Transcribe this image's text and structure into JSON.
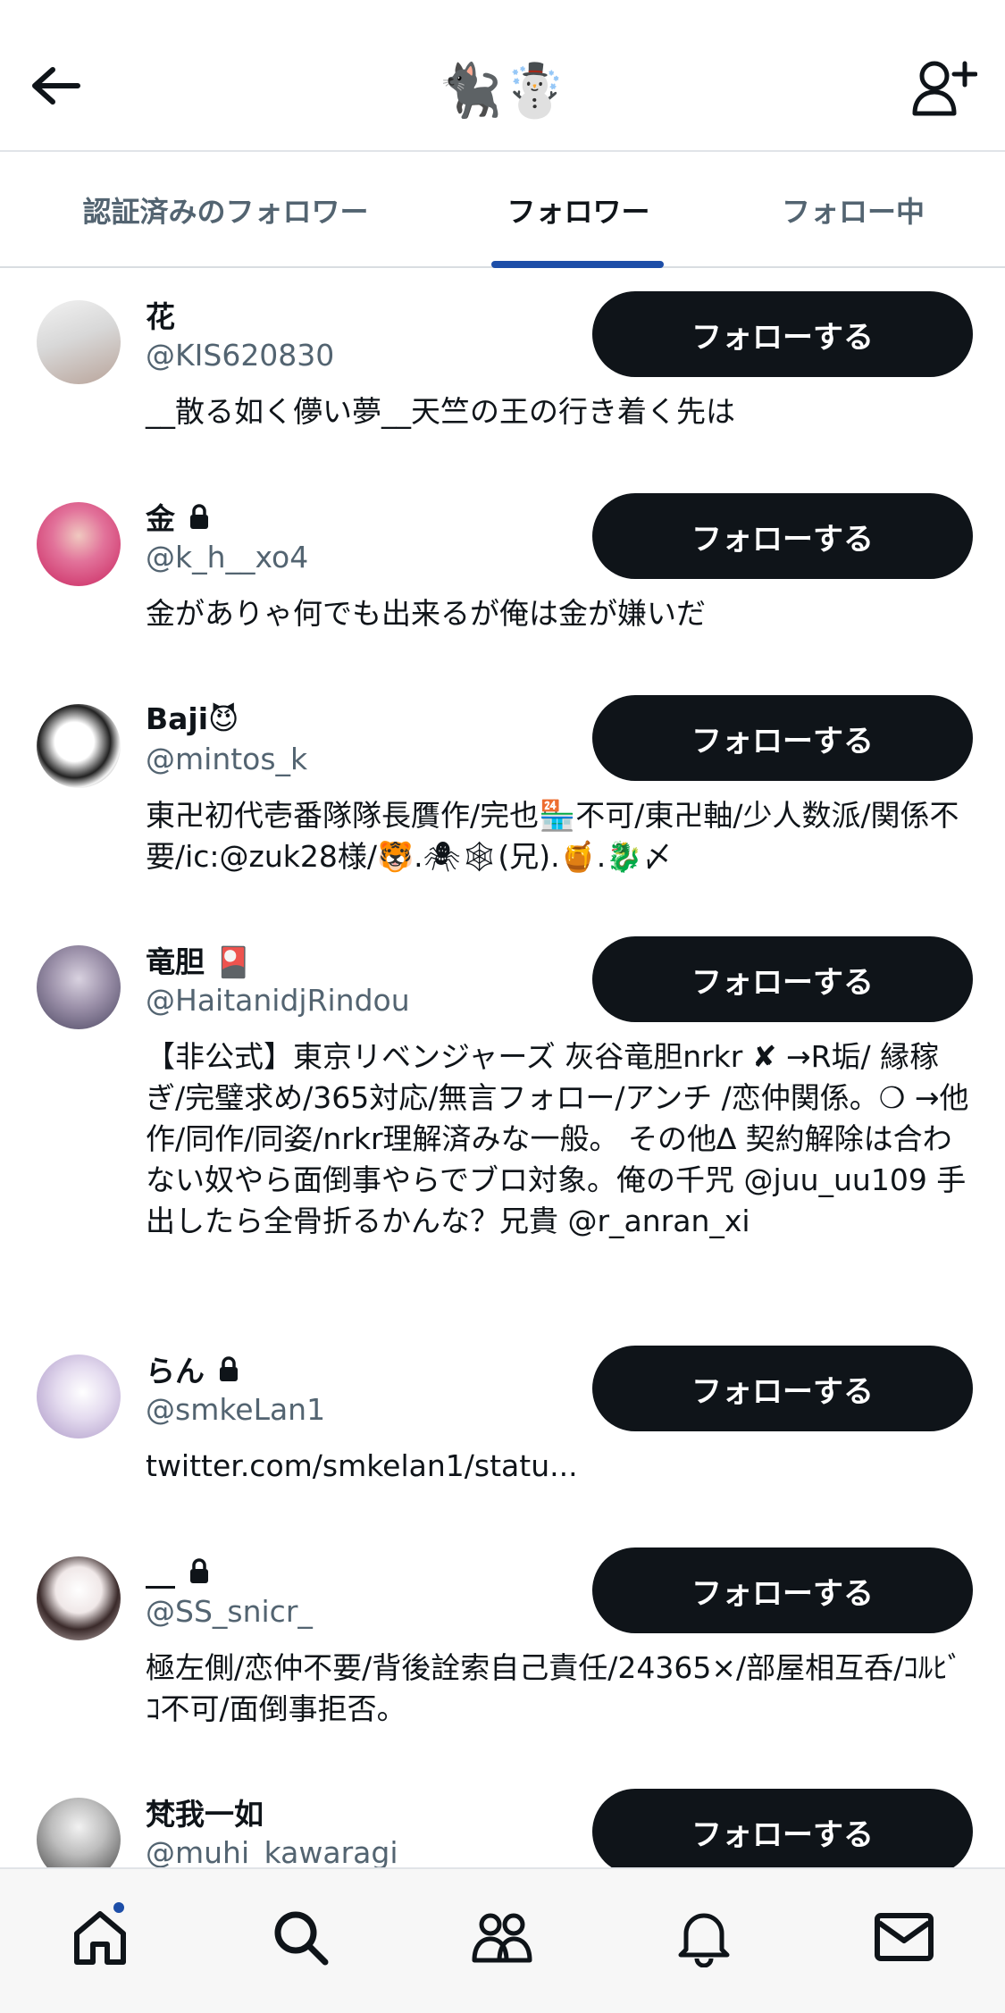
{
  "header": {
    "title": "🐈‍⬛☃️",
    "back_icon": "arrow-left-icon",
    "add_icon": "add-user-icon"
  },
  "tabs": [
    {
      "label": "認証済みのフォロワー",
      "active": false
    },
    {
      "label": "フォロワー",
      "active": true
    },
    {
      "label": "フォロー中",
      "active": false
    }
  ],
  "colors": {
    "accent": "#1d4ea8",
    "button_bg": "#0f1419",
    "secondary_text": "#536471"
  },
  "follow_label": "フォローする",
  "users": [
    {
      "name": "花",
      "handle": "@KIS620830",
      "locked": false,
      "bio": "__散る如く儚い夢__天竺の王の行き着く先は"
    },
    {
      "name": "金",
      "handle": "@k_h__xo4",
      "locked": true,
      "bio": "金がありゃ何でも出来るが俺は金が嫌いだ"
    },
    {
      "name": "Baji😈",
      "handle": "@mintos_k",
      "locked": false,
      "bio": "東卍初代壱番隊隊長贋作/完也🏪不可/東卍軸/少人数派/関係不要/ic:@zuk28様/🐯.🕷🕸(兄).🍯.🐉〆"
    },
    {
      "name": "竜胆 🎴",
      "handle": "@HaitanidjRindou",
      "locked": false,
      "bio": "【非公式】東京リベンジャーズ 灰谷竜胆nrkr ✘ →R垢/ 縁稼ぎ/完璧求め/365対応/無言フォロー/アンチ /恋仲関係。❍ →他作/同作/同姿/nrkr理解済みな一般。 その他∆ 契約解除は合わない奴やら面倒事やらでブロ対象。俺の千咒 @juu_uu109 手出したら全骨折るかんな？兄貴 @r_anran_xi"
    },
    {
      "name": "らん",
      "handle": "@smkeLan1",
      "locked": true,
      "bio": "twitter.com/smkelan1/statu..."
    },
    {
      "name": "__",
      "handle": "@SS_snicr_",
      "locked": true,
      "bio": "極左側/恋仲不要/背後詮索自己責任/24365×/部屋相互呑/ｺﾙﾋﾞｺ不可/面倒事拒否。"
    },
    {
      "name": "梵我一如",
      "handle": "@muhi_kawaragi",
      "locked": false,
      "bio": ""
    }
  ],
  "bottom_nav": [
    {
      "name": "home-icon",
      "badge": true
    },
    {
      "name": "search-icon",
      "badge": false
    },
    {
      "name": "communities-icon",
      "badge": false
    },
    {
      "name": "notifications-icon",
      "badge": false
    },
    {
      "name": "messages-icon",
      "badge": false
    }
  ]
}
